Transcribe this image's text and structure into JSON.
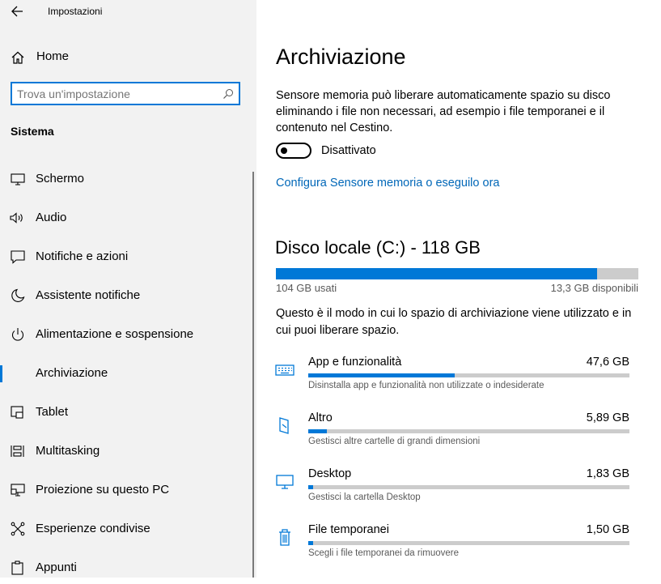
{
  "window": {
    "title": "Impostazioni"
  },
  "sidebar": {
    "home_label": "Home",
    "search_placeholder": "Trova un'impostazione",
    "search_value": "",
    "section_title": "Sistema",
    "items": [
      {
        "label": "Schermo",
        "icon": "monitor-icon",
        "active": false
      },
      {
        "label": "Audio",
        "icon": "speaker-icon",
        "active": false
      },
      {
        "label": "Notifiche e azioni",
        "icon": "notification-icon",
        "active": false
      },
      {
        "label": "Assistente notifiche",
        "icon": "moon-icon",
        "active": false
      },
      {
        "label": "Alimentazione e sospensione",
        "icon": "power-icon",
        "active": false
      },
      {
        "label": "Archiviazione",
        "icon": "storage-icon",
        "active": true
      },
      {
        "label": "Tablet",
        "icon": "tablet-icon",
        "active": false
      },
      {
        "label": "Multitasking",
        "icon": "multitasking-icon",
        "active": false
      },
      {
        "label": "Proiezione su questo PC",
        "icon": "projection-icon",
        "active": false
      },
      {
        "label": "Esperienze condivise",
        "icon": "shared-experiences-icon",
        "active": false
      },
      {
        "label": "Appunti",
        "icon": "clipboard-icon",
        "active": false
      }
    ]
  },
  "main": {
    "title": "Archiviazione",
    "description": "Sensore memoria può liberare automaticamente spazio su disco eliminando i file non necessari, ad esempio i file temporanei e il contenuto nel Cestino.",
    "toggle": {
      "state": "off",
      "label": "Disattivato"
    },
    "configure_link": "Configura Sensore memoria o eseguilo ora",
    "disk": {
      "title": "Disco locale (C:) - 118 GB",
      "used_label": "104 GB usati",
      "free_label": "13,3 GB disponibili",
      "used_fraction": 0.887
    },
    "usage_description": "Questo è il modo in cui lo spazio di archiviazione viene utilizzato e in cui puoi liberare spazio.",
    "categories": [
      {
        "name": "App e funzionalità",
        "size": "47,6 GB",
        "subtitle": "Disinstalla app e funzionalità non utilizzate o indesiderate",
        "icon": "keyboard-icon",
        "fraction": 0.457
      },
      {
        "name": "Altro",
        "size": "5,89 GB",
        "subtitle": "Gestisci altre cartelle di grandi dimensioni",
        "icon": "folder-icon",
        "fraction": 0.057
      },
      {
        "name": "Desktop",
        "size": "1,83 GB",
        "subtitle": "Gestisci la cartella Desktop",
        "icon": "desktop-icon",
        "fraction": 0.015
      },
      {
        "name": "File temporanei",
        "size": "1,50 GB",
        "subtitle": "Scegli i file temporanei da rimuovere",
        "icon": "trash-icon",
        "fraction": 0.015
      }
    ]
  },
  "colors": {
    "accent": "#0078d7",
    "link": "#0067b8",
    "sidebar_bg": "#f2f2f2",
    "track": "#cccccc"
  }
}
